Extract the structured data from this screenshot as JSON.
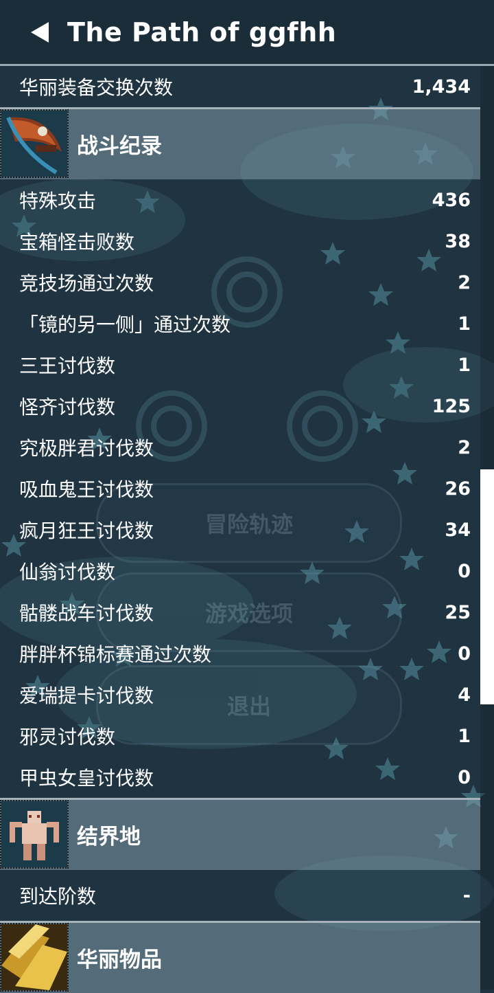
{
  "header": {
    "title": "The Path of ggfhh"
  },
  "background_menu": {
    "items": [
      "冒险轨迹",
      "游戏选项",
      "退出"
    ]
  },
  "top_row": {
    "label": "华丽装备交换次数",
    "value": "1,434"
  },
  "sections": {
    "battle": {
      "title": "战斗纪录",
      "rows": [
        {
          "label": "特殊攻击",
          "value": "436"
        },
        {
          "label": "宝箱怪击败数",
          "value": "38"
        },
        {
          "label": "竞技场通过次数",
          "value": "2"
        },
        {
          "label": "「镜的另一侧」通过次数",
          "value": "1"
        },
        {
          "label": "三王讨伐数",
          "value": "1"
        },
        {
          "label": "怪齐讨伐数",
          "value": "125"
        },
        {
          "label": "究极胖君讨伐数",
          "value": "2"
        },
        {
          "label": "吸血鬼王讨伐数",
          "value": "26"
        },
        {
          "label": "疯月狂王讨伐数",
          "value": "34"
        },
        {
          "label": "仙翁讨伐数",
          "value": "0"
        },
        {
          "label": "骷髅战车讨伐数",
          "value": "25"
        },
        {
          "label": "胖胖杯锦标赛通过次数",
          "value": "0"
        },
        {
          "label": "爱瑞提卡讨伐数",
          "value": "4"
        },
        {
          "label": "邪灵讨伐数",
          "value": "1"
        },
        {
          "label": "甲虫女皇讨伐数",
          "value": "0"
        }
      ]
    },
    "barrier": {
      "title": "结界地",
      "rows": [
        {
          "label": "到达阶数",
          "value": "-"
        }
      ]
    },
    "fancy": {
      "title": "华丽物品"
    }
  },
  "colors": {
    "background": "#1f3340",
    "section_band": "#809aa9",
    "star": "#3d6675",
    "text": "#ffffff"
  },
  "icons": [
    "back-arrow-icon",
    "scythe-weapon-icon",
    "monkey-warrior-icon",
    "golden-treasure-icon"
  ]
}
